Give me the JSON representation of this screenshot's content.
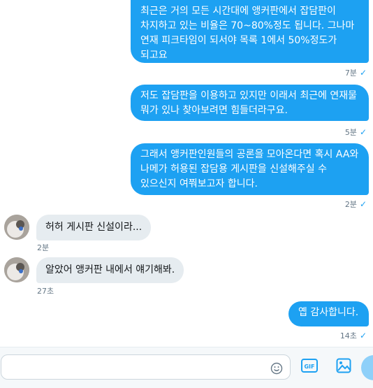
{
  "messages": [
    {
      "text": "최근은 거의 모든 시간대에 앵커판에서 잡담판이 차지하고 있는 비율은 70~80%정도 됩니다.  그나마 연재 피크타임이 되서야 목록 1에서 50%정도가 되고요",
      "time": "7분"
    },
    {
      "text": "저도 잡담판을 이용하고 있지만 이래서 최근에 연재물 뭐가 있나 찾아보려면 힘들더라구요.",
      "time": "5분"
    },
    {
      "text": "그래서 앵커판인원들의 공론을 모아온다면 혹시 AA와 나메가 허용된 잡담용 게시판을 신설해주실 수 있으신지 여쭤보고자 합니다.",
      "time": "2분"
    },
    {
      "text": "허허 게시판 신설이라...",
      "time": "2분"
    },
    {
      "text": "알았어 앵커판 내에서 얘기해봐.",
      "time": "27초"
    },
    {
      "text": "옙 감사합니다.",
      "time": "14초"
    }
  ],
  "icons": {
    "read_receipt": "check-icon",
    "emoji": "emoji-icon",
    "gif": "gif-icon",
    "image": "image-icon",
    "send": "send-icon"
  },
  "gif_label": "GIF",
  "colors": {
    "accent": "#1da1f2",
    "incoming": "#e6ecf0",
    "meta": "#657786"
  }
}
